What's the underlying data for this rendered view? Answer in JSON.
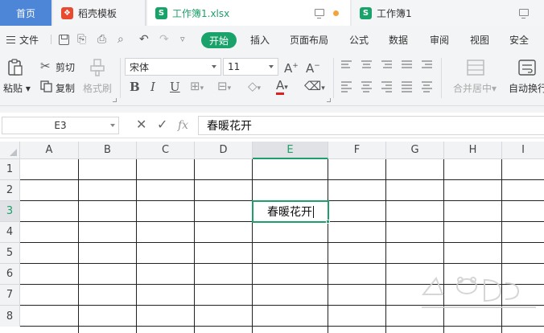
{
  "tabs": {
    "home": "首页",
    "template": "稻壳模板",
    "workbook_active": "工作簿1.xlsx",
    "workbook2": "工作簿1",
    "tab_icon_letter": "S"
  },
  "menu": {
    "file": "文件",
    "start": "开始",
    "items": [
      "插入",
      "页面布局",
      "公式",
      "数据",
      "审阅",
      "视图",
      "安全"
    ]
  },
  "ribbon": {
    "cut": "剪切",
    "copy": "复制",
    "paste": "粘贴",
    "format_painter": "格式刷",
    "font_name": "宋体",
    "font_size": "11",
    "merge_center": "合并居中",
    "wrap_text": "自动换行"
  },
  "formula_bar": {
    "cell_ref": "E3",
    "fx": "fx",
    "content": "春暖花开"
  },
  "grid": {
    "columns": [
      "A",
      "B",
      "C",
      "D",
      "E",
      "F",
      "G",
      "H",
      "I"
    ],
    "rows": [
      "1",
      "2",
      "3",
      "4",
      "5",
      "6",
      "7",
      "8"
    ],
    "selected_column": "E",
    "selected_row": "3",
    "active_cell_value": "春暖花开"
  },
  "colors": {
    "accent": "#1e9e6a",
    "home_tab": "#4d86d6",
    "template_icon": "#e8492f"
  },
  "icons": [
    "hamburger-icon",
    "save-icon",
    "undo-icon",
    "redo-icon",
    "print-icon",
    "cut-icon",
    "copy-icon",
    "paste-icon",
    "format-painter-icon",
    "bold-icon",
    "italic-icon",
    "underline-icon",
    "border-icon",
    "fill-color-icon",
    "font-color-icon",
    "eraser-icon",
    "cancel-icon",
    "confirm-icon",
    "fx-icon",
    "monitor-icon"
  ]
}
